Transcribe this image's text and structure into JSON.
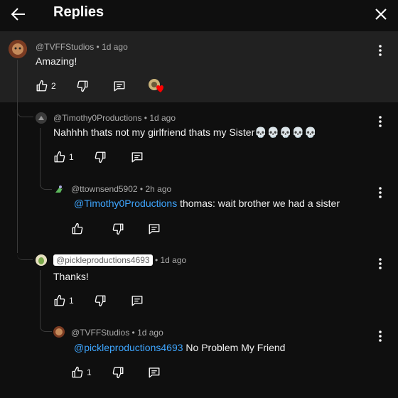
{
  "header": {
    "title": "Replies"
  },
  "comments": [
    {
      "handle": "@TVFFStudios",
      "time": "1d ago",
      "text": "Amazing!",
      "likes": "2"
    },
    {
      "handle": "@Timothy0Productions",
      "time": "1d ago",
      "text": "Nahhhh thats not my girlfriend thats my Sister",
      "emoji": "💀💀💀💀💀",
      "likes": "1"
    },
    {
      "handle": "@ttownsend5902",
      "time": "2h ago",
      "mention": "@Timothy0Productions",
      "text": " thomas: wait brother we had a sister",
      "likes": ""
    },
    {
      "handle": "@pickleproductions4693",
      "time": "1d ago",
      "text": "Thanks!",
      "likes": "1"
    },
    {
      "handle": "@TVFFStudios",
      "time": "1d ago",
      "mention": "@pickleproductions4693",
      "text": " No Problem My Friend",
      "likes": "1"
    }
  ],
  "meta_separator": " • ",
  "colors": {
    "background": "#0f0f0f",
    "highlight": "#212121",
    "mention": "#3ea6ff",
    "heart": "#ff0000"
  }
}
